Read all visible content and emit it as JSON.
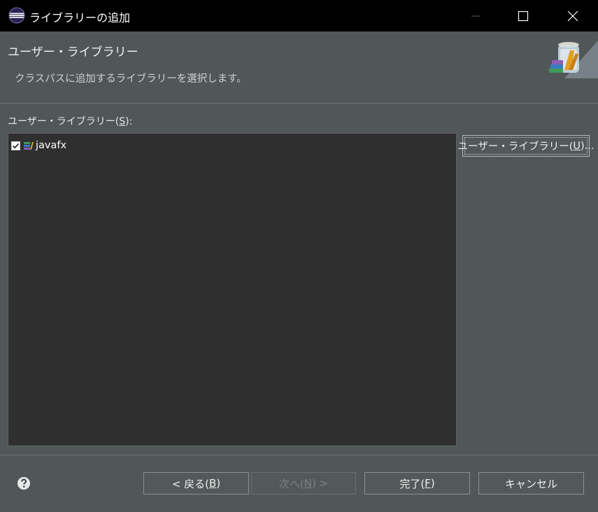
{
  "window": {
    "title": "ライブラリーの追加"
  },
  "header": {
    "title": "ユーザー・ライブラリー",
    "description": "クラスパスに追加するライブラリーを選択します。"
  },
  "list": {
    "label_prefix": "ユーザー・ライブラリー(",
    "label_mnemonic": "S",
    "label_suffix": "):",
    "items": [
      {
        "name": "javafx",
        "checked": true
      }
    ]
  },
  "side_button": {
    "label_prefix": "ユーザー・ライブラリー(",
    "label_mnemonic": "U",
    "label_suffix": ")..."
  },
  "footer": {
    "back": {
      "prefix": "< 戻る(",
      "mnemonic": "B",
      "suffix": ")"
    },
    "next": {
      "prefix": "次へ(",
      "mnemonic": "N",
      "suffix": ") >"
    },
    "finish": {
      "prefix": "完了(",
      "mnemonic": "F",
      "suffix": ")"
    },
    "cancel": {
      "label": "キャンセル"
    }
  },
  "colors": {
    "background": "#515658",
    "titlebar": "#000000",
    "list_bg": "#2f2f2f"
  },
  "icons": {
    "app": "eclipse-icon",
    "header": "library-jar-icon",
    "library": "library-icon",
    "help": "help-icon"
  }
}
